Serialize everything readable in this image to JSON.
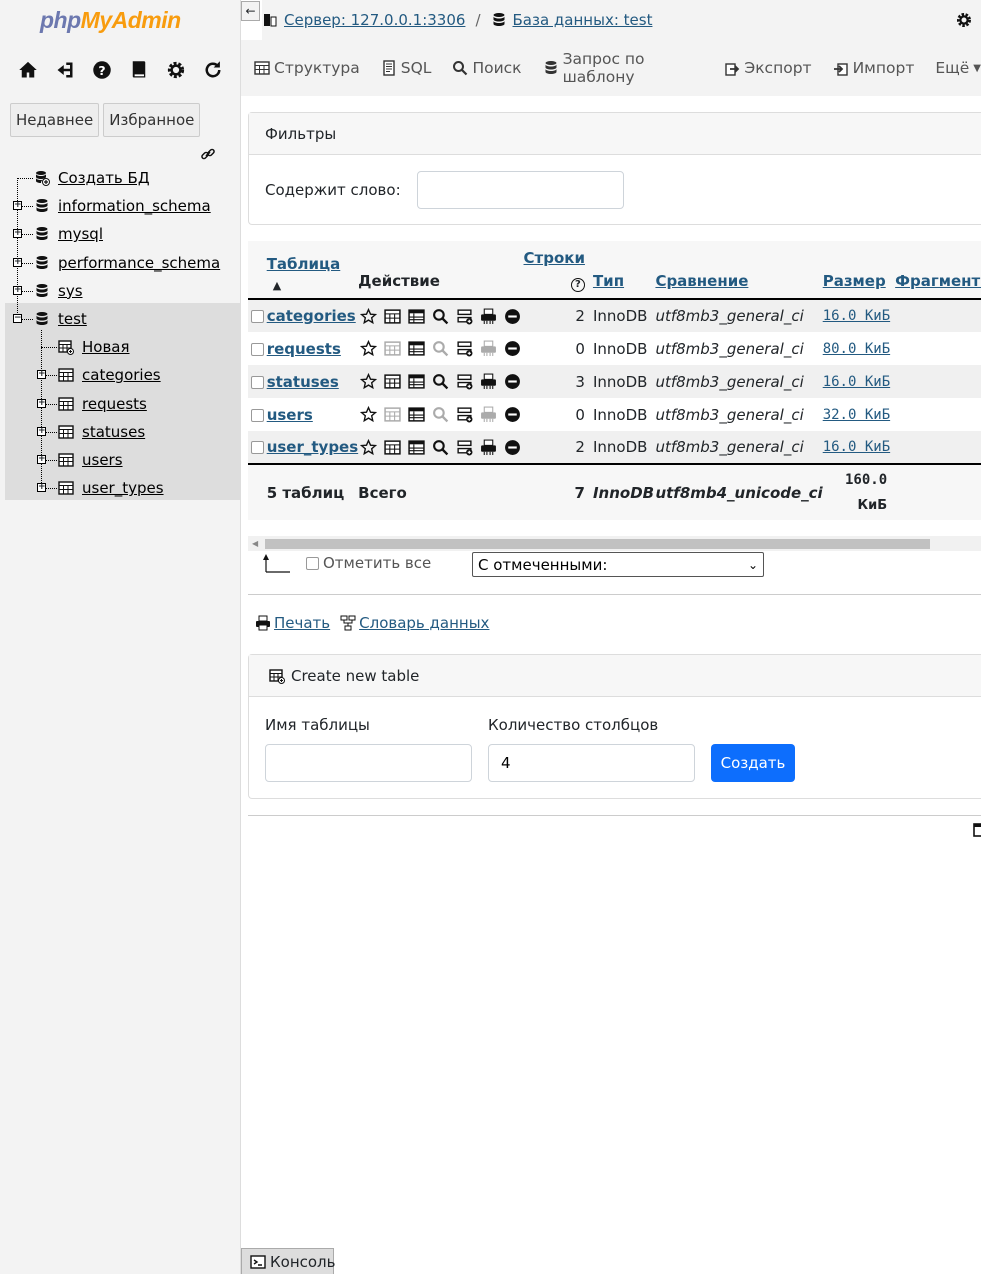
{
  "logo": {
    "php": "php",
    "myadmin": "MyAdmin"
  },
  "nav_icons": [
    "home-icon",
    "logout-icon",
    "help-icon",
    "docs-icon",
    "settings-icon",
    "reload-icon"
  ],
  "nav": {
    "recent": "Недавнее",
    "favorites": "Избранное"
  },
  "tree": {
    "create_db": "Создать БД",
    "dbs": [
      "information_schema",
      "mysql",
      "performance_schema",
      "sys",
      "test"
    ],
    "test_children": [
      "Новая",
      "categories",
      "requests",
      "statuses",
      "users",
      "user_types"
    ]
  },
  "breadcrumb": {
    "collapse": "←",
    "server": "Сервер: 127.0.0.1:3306",
    "sep": "/",
    "database": "База данных: test"
  },
  "menu": {
    "structure": "Структура",
    "sql": "SQL",
    "search": "Поиск",
    "query": "Запрос по шаблону",
    "export": "Экспорт",
    "import": "Импорт",
    "more": "Ещё"
  },
  "filters": {
    "title": "Фильтры",
    "label": "Содержит слово:",
    "value": ""
  },
  "table": {
    "headers": {
      "table": "Таблица",
      "action": "Действие",
      "rows": "Строки",
      "rows_help": "?",
      "type": "Тип",
      "collation": "Сравнение",
      "size": "Размер",
      "overhead": "Фрагментир"
    },
    "rows": [
      {
        "name": "categories",
        "rows": "2",
        "engine": "InnoDB",
        "collation": "utf8mb3_general_ci",
        "size": "16.0 КиБ"
      },
      {
        "name": "requests",
        "rows": "0",
        "engine": "InnoDB",
        "collation": "utf8mb3_general_ci",
        "size": "80.0 КиБ"
      },
      {
        "name": "statuses",
        "rows": "3",
        "engine": "InnoDB",
        "collation": "utf8mb3_general_ci",
        "size": "16.0 КиБ"
      },
      {
        "name": "users",
        "rows": "0",
        "engine": "InnoDB",
        "collation": "utf8mb3_general_ci",
        "size": "32.0 КиБ"
      },
      {
        "name": "user_types",
        "rows": "2",
        "engine": "InnoDB",
        "collation": "utf8mb3_general_ci",
        "size": "16.0 КиБ"
      }
    ],
    "footer": {
      "count": "5 таблиц",
      "total": "Всего",
      "rows": "7",
      "engine": "InnoDB",
      "collation": "utf8mb4_unicode_ci",
      "size1": "160.0",
      "size2": "КиБ"
    }
  },
  "bulk": {
    "check_all": "Отметить все",
    "with_selected": "С отмеченными:"
  },
  "links": {
    "print": "Печать",
    "dictionary": "Словарь данных"
  },
  "create": {
    "title": "Create new table",
    "name_label": "Имя таблицы",
    "name_value": "",
    "cols_label": "Количество столбцов",
    "cols_value": "4",
    "button": "Создать"
  },
  "console": "Консоль"
}
